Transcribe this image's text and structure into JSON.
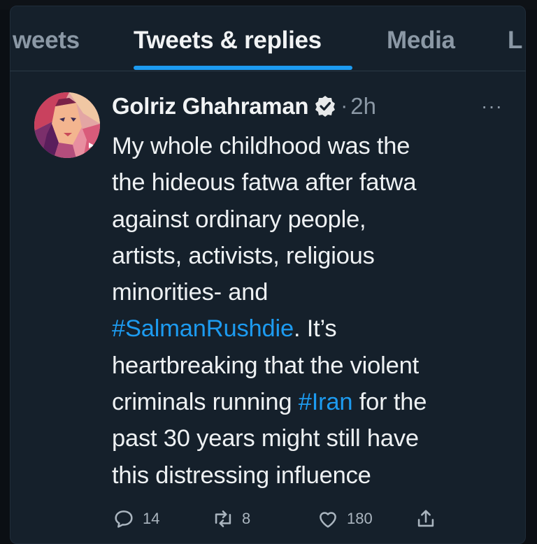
{
  "tabs": [
    {
      "label": "weets"
    },
    {
      "label": "Tweets & replies"
    },
    {
      "label": "Media"
    },
    {
      "label": "L"
    }
  ],
  "tweet": {
    "author_name": "Golriz Ghahraman",
    "separator": "·",
    "time": "2h",
    "more": "···",
    "lines": {
      "l1": "My whole childhood was the",
      "l2": "the hideous fatwa after fatwa",
      "l3": "against ordinary people,",
      "l4": "artists, activists, religious",
      "l5": "minorities- and",
      "l6_tag": "#SalmanRushdie",
      "l6_rest": ". It’s",
      "l7": "heartbreaking that the violent",
      "l8_pre": "criminals running ",
      "l8_tag": "#Iran",
      "l8_post": " for the",
      "l9": "past 30 years might still have",
      "l10": "this distressing influence"
    },
    "actions": {
      "replies": "14",
      "retweets": "8",
      "likes": "180"
    }
  },
  "icons": {
    "verified": "verified-badge-icon",
    "reply": "comment-icon",
    "retweet": "retweet-icon",
    "like": "heart-icon",
    "share": "share-icon"
  },
  "colors": {
    "background": "#15202b",
    "accent": "#1d9bf0",
    "muted": "#8b98a5"
  }
}
